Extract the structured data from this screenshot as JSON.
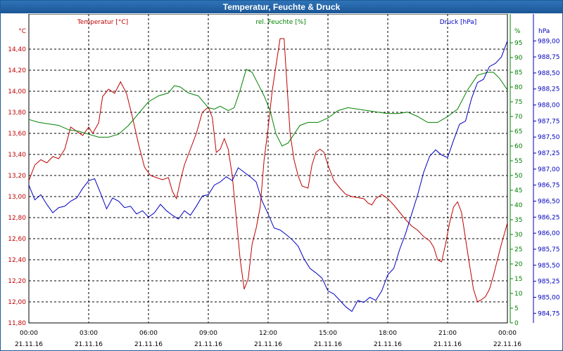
{
  "window": {
    "title": "Temperatur, Feuchte & Druck"
  },
  "colors": {
    "temperature": "#c00000",
    "humidity": "#008000",
    "pressure": "#0000c0",
    "grid": "#000000",
    "axis_text": "#000000"
  },
  "chart_data": {
    "type": "line",
    "title": "Temperatur, Feuchte & Druck",
    "x_axis": {
      "range_hours": [
        0,
        24
      ],
      "ticks": [
        {
          "hour": 0,
          "time": "00:00",
          "date": "21.11.16"
        },
        {
          "hour": 3,
          "time": "03:00",
          "date": "21.11.16"
        },
        {
          "hour": 6,
          "time": "06:00",
          "date": "21.11.16"
        },
        {
          "hour": 9,
          "time": "09:00",
          "date": "21.11.16"
        },
        {
          "hour": 12,
          "time": "12:00",
          "date": "21.11.16"
        },
        {
          "hour": 15,
          "time": "15:00",
          "date": "21.11.16"
        },
        {
          "hour": 18,
          "time": "18:00",
          "date": "21.11.16"
        },
        {
          "hour": 21,
          "time": "21:00",
          "date": "21.11.16"
        },
        {
          "hour": 24,
          "time": "00:00",
          "date": "22.11.16"
        }
      ]
    },
    "axes": {
      "left": {
        "label": "Temperatur [°C]",
        "unit": "°C",
        "range": [
          11.8,
          14.6
        ],
        "ticks": [
          "11,80",
          "12,00",
          "12,20",
          "12,40",
          "12,60",
          "12,80",
          "13,00",
          "13,20",
          "13,40",
          "13,60",
          "13,80",
          "14,00",
          "14,20",
          "14,40"
        ]
      },
      "middle": {
        "label": "rel. Feuchte [%]",
        "unit": "%",
        "range": [
          0,
          100
        ],
        "ticks": [
          "0",
          "5",
          "10",
          "15",
          "20",
          "25",
          "30",
          "35",
          "40",
          "45",
          "50",
          "55",
          "60",
          "65",
          "70",
          "75",
          "80",
          "85",
          "90",
          "95"
        ]
      },
      "right": {
        "label": "Druck [hPa]",
        "unit": "hPa",
        "range": [
          984.6,
          989.2
        ],
        "ticks": [
          "984,75",
          "985,00",
          "985,25",
          "985,50",
          "985,75",
          "986,00",
          "986,25",
          "986,50",
          "986,75",
          "987,00",
          "987,25",
          "987,50",
          "987,75",
          "988,00",
          "988,25",
          "988,50",
          "988,75",
          "989,00"
        ]
      }
    },
    "grid": true,
    "series": [
      {
        "name": "Temperatur [°C]",
        "axis": "left",
        "color": "#c00000",
        "points": [
          [
            0,
            13.15
          ],
          [
            0.3,
            13.3
          ],
          [
            0.6,
            13.35
          ],
          [
            0.9,
            13.32
          ],
          [
            1.2,
            13.38
          ],
          [
            1.5,
            13.36
          ],
          [
            1.8,
            13.45
          ],
          [
            2.1,
            13.66
          ],
          [
            2.4,
            13.62
          ],
          [
            2.7,
            13.58
          ],
          [
            3.0,
            13.66
          ],
          [
            3.2,
            13.6
          ],
          [
            3.5,
            13.7
          ],
          [
            3.7,
            13.95
          ],
          [
            4.0,
            14.02
          ],
          [
            4.3,
            13.98
          ],
          [
            4.6,
            14.09
          ],
          [
            4.9,
            13.98
          ],
          [
            5.2,
            13.75
          ],
          [
            5.5,
            13.5
          ],
          [
            5.8,
            13.28
          ],
          [
            6.1,
            13.2
          ],
          [
            6.4,
            13.18
          ],
          [
            6.7,
            13.16
          ],
          [
            7.0,
            13.18
          ],
          [
            7.2,
            13.05
          ],
          [
            7.4,
            12.98
          ],
          [
            7.6,
            13.15
          ],
          [
            7.8,
            13.3
          ],
          [
            8.1,
            13.45
          ],
          [
            8.4,
            13.6
          ],
          [
            8.7,
            13.8
          ],
          [
            9.0,
            13.85
          ],
          [
            9.2,
            13.75
          ],
          [
            9.4,
            13.42
          ],
          [
            9.6,
            13.45
          ],
          [
            9.8,
            13.55
          ],
          [
            10.0,
            13.45
          ],
          [
            10.2,
            13.2
          ],
          [
            10.4,
            12.8
          ],
          [
            10.6,
            12.4
          ],
          [
            10.8,
            12.12
          ],
          [
            11.0,
            12.22
          ],
          [
            11.2,
            12.55
          ],
          [
            11.4,
            12.7
          ],
          [
            11.6,
            12.9
          ],
          [
            11.8,
            13.35
          ],
          [
            12.0,
            13.65
          ],
          [
            12.2,
            14.0
          ],
          [
            12.4,
            14.25
          ],
          [
            12.6,
            14.5
          ],
          [
            12.8,
            14.5
          ],
          [
            12.9,
            14.2
          ],
          [
            13.1,
            13.6
          ],
          [
            13.3,
            13.35
          ],
          [
            13.5,
            13.2
          ],
          [
            13.7,
            13.1
          ],
          [
            14.0,
            13.08
          ],
          [
            14.2,
            13.3
          ],
          [
            14.4,
            13.42
          ],
          [
            14.6,
            13.45
          ],
          [
            14.8,
            13.42
          ],
          [
            15.0,
            13.3
          ],
          [
            15.3,
            13.15
          ],
          [
            15.6,
            13.08
          ],
          [
            15.9,
            13.02
          ],
          [
            16.2,
            13.0
          ],
          [
            16.5,
            12.99
          ],
          [
            16.8,
            12.98
          ],
          [
            17.0,
            12.94
          ],
          [
            17.2,
            12.92
          ],
          [
            17.4,
            12.98
          ],
          [
            17.7,
            13.02
          ],
          [
            18.0,
            12.98
          ],
          [
            18.3,
            12.92
          ],
          [
            18.6,
            12.85
          ],
          [
            18.9,
            12.78
          ],
          [
            19.2,
            12.72
          ],
          [
            19.5,
            12.68
          ],
          [
            19.8,
            12.62
          ],
          [
            20.1,
            12.58
          ],
          [
            20.3,
            12.52
          ],
          [
            20.5,
            12.4
          ],
          [
            20.7,
            12.38
          ],
          [
            20.9,
            12.55
          ],
          [
            21.1,
            12.75
          ],
          [
            21.3,
            12.9
          ],
          [
            21.5,
            12.95
          ],
          [
            21.7,
            12.85
          ],
          [
            21.9,
            12.6
          ],
          [
            22.1,
            12.35
          ],
          [
            22.3,
            12.12
          ],
          [
            22.5,
            12.0
          ],
          [
            22.7,
            12.02
          ],
          [
            22.9,
            12.05
          ],
          [
            23.1,
            12.12
          ],
          [
            23.3,
            12.25
          ],
          [
            23.5,
            12.4
          ],
          [
            23.7,
            12.55
          ],
          [
            23.85,
            12.65
          ],
          [
            24.0,
            12.75
          ]
        ]
      },
      {
        "name": "rel. Feuchte [%]",
        "axis": "middle",
        "color": "#008000",
        "points": [
          [
            0,
            69
          ],
          [
            0.5,
            68
          ],
          [
            1.0,
            67.5
          ],
          [
            1.5,
            67
          ],
          [
            2.0,
            65.5
          ],
          [
            2.5,
            65
          ],
          [
            3.0,
            64
          ],
          [
            3.5,
            63
          ],
          [
            4.0,
            63
          ],
          [
            4.5,
            64
          ],
          [
            5.0,
            67
          ],
          [
            5.5,
            71
          ],
          [
            6.0,
            75
          ],
          [
            6.5,
            77
          ],
          [
            7.0,
            78
          ],
          [
            7.3,
            80.5
          ],
          [
            7.6,
            80
          ],
          [
            8.0,
            78
          ],
          [
            8.5,
            77
          ],
          [
            9.0,
            73
          ],
          [
            9.3,
            72.5
          ],
          [
            9.6,
            73.5
          ],
          [
            10.0,
            72
          ],
          [
            10.3,
            73
          ],
          [
            10.6,
            79
          ],
          [
            10.9,
            86
          ],
          [
            11.2,
            85
          ],
          [
            11.5,
            81
          ],
          [
            11.8,
            77
          ],
          [
            12.1,
            72
          ],
          [
            12.4,
            64
          ],
          [
            12.7,
            60
          ],
          [
            13.0,
            61
          ],
          [
            13.3,
            64
          ],
          [
            13.6,
            67
          ],
          [
            14.0,
            68
          ],
          [
            14.5,
            68
          ],
          [
            15.0,
            69.5
          ],
          [
            15.5,
            72
          ],
          [
            16.0,
            73
          ],
          [
            16.5,
            72.5
          ],
          [
            17.0,
            72
          ],
          [
            17.5,
            71.5
          ],
          [
            18.0,
            71
          ],
          [
            18.5,
            71
          ],
          [
            19.0,
            71.5
          ],
          [
            19.5,
            70
          ],
          [
            20.0,
            68
          ],
          [
            20.5,
            68
          ],
          [
            21.0,
            70
          ],
          [
            21.5,
            72.5
          ],
          [
            22.0,
            79
          ],
          [
            22.5,
            84
          ],
          [
            23.0,
            85
          ],
          [
            23.3,
            85
          ],
          [
            23.6,
            83
          ],
          [
            24.0,
            79
          ]
        ]
      },
      {
        "name": "Druck [hPa]",
        "axis": "right",
        "color": "#0000c0",
        "points": [
          [
            0,
            986.75
          ],
          [
            0.3,
            986.52
          ],
          [
            0.6,
            986.6
          ],
          [
            0.9,
            986.45
          ],
          [
            1.2,
            986.32
          ],
          [
            1.5,
            986.4
          ],
          [
            1.8,
            986.42
          ],
          [
            2.1,
            986.5
          ],
          [
            2.4,
            986.55
          ],
          [
            2.7,
            986.7
          ],
          [
            3.0,
            986.82
          ],
          [
            3.3,
            986.85
          ],
          [
            3.6,
            986.62
          ],
          [
            3.9,
            986.38
          ],
          [
            4.2,
            986.55
          ],
          [
            4.5,
            986.5
          ],
          [
            4.8,
            986.4
          ],
          [
            5.1,
            986.42
          ],
          [
            5.4,
            986.3
          ],
          [
            5.7,
            986.35
          ],
          [
            6.0,
            986.25
          ],
          [
            6.3,
            986.32
          ],
          [
            6.6,
            986.45
          ],
          [
            6.9,
            986.35
          ],
          [
            7.2,
            986.28
          ],
          [
            7.5,
            986.22
          ],
          [
            7.8,
            986.35
          ],
          [
            8.1,
            986.28
          ],
          [
            8.4,
            986.42
          ],
          [
            8.7,
            986.58
          ],
          [
            9.0,
            986.6
          ],
          [
            9.3,
            986.75
          ],
          [
            9.6,
            986.8
          ],
          [
            9.9,
            986.88
          ],
          [
            10.2,
            986.82
          ],
          [
            10.5,
            987.02
          ],
          [
            10.8,
            986.95
          ],
          [
            11.1,
            986.88
          ],
          [
            11.4,
            986.8
          ],
          [
            11.7,
            986.5
          ],
          [
            12.0,
            986.3
          ],
          [
            12.3,
            986.08
          ],
          [
            12.6,
            986.05
          ],
          [
            12.9,
            985.98
          ],
          [
            13.2,
            985.9
          ],
          [
            13.5,
            985.8
          ],
          [
            13.8,
            985.6
          ],
          [
            14.1,
            985.45
          ],
          [
            14.4,
            985.38
          ],
          [
            14.7,
            985.3
          ],
          [
            15.0,
            985.1
          ],
          [
            15.3,
            985.05
          ],
          [
            15.6,
            984.95
          ],
          [
            15.9,
            984.85
          ],
          [
            16.2,
            984.78
          ],
          [
            16.5,
            984.95
          ],
          [
            16.8,
            984.92
          ],
          [
            17.1,
            985.0
          ],
          [
            17.4,
            984.95
          ],
          [
            17.7,
            985.1
          ],
          [
            18.0,
            985.35
          ],
          [
            18.3,
            985.45
          ],
          [
            18.6,
            985.75
          ],
          [
            18.9,
            986.0
          ],
          [
            19.2,
            986.3
          ],
          [
            19.5,
            986.6
          ],
          [
            19.8,
            986.95
          ],
          [
            20.1,
            987.2
          ],
          [
            20.4,
            987.3
          ],
          [
            20.7,
            987.22
          ],
          [
            21.0,
            987.18
          ],
          [
            21.3,
            987.45
          ],
          [
            21.6,
            987.7
          ],
          [
            21.9,
            987.75
          ],
          [
            22.2,
            988.1
          ],
          [
            22.5,
            988.35
          ],
          [
            22.8,
            988.4
          ],
          [
            23.1,
            988.6
          ],
          [
            23.4,
            988.65
          ],
          [
            23.7,
            988.75
          ],
          [
            24.0,
            989.0
          ]
        ]
      }
    ]
  }
}
